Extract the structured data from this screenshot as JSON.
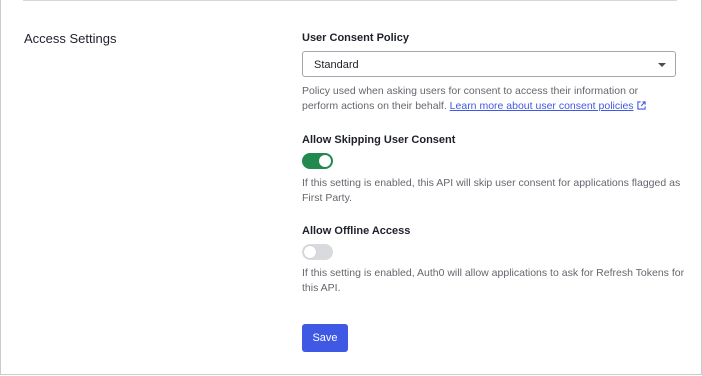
{
  "section": {
    "title": "Access Settings"
  },
  "user_consent_policy": {
    "label": "User Consent Policy",
    "selected": "Standard",
    "help_text": "Policy used when asking users for consent to access their information or perform actions on their behalf.",
    "link_text": "Learn more about user consent policies",
    "link_icon": "external-link-icon"
  },
  "allow_skipping_consent": {
    "label": "Allow Skipping User Consent",
    "enabled": true,
    "help_text": "If this setting is enabled, this API will skip user consent for applications flagged as First Party."
  },
  "allow_offline_access": {
    "label": "Allow Offline Access",
    "enabled": false,
    "help_text": "If this setting is enabled, Auth0 will allow applications to ask for Refresh Tokens for this API."
  },
  "actions": {
    "save_label": "Save"
  },
  "colors": {
    "primary": "#3f59e4",
    "toggle_on": "#228a4f",
    "toggle_off": "#d9dadd"
  }
}
